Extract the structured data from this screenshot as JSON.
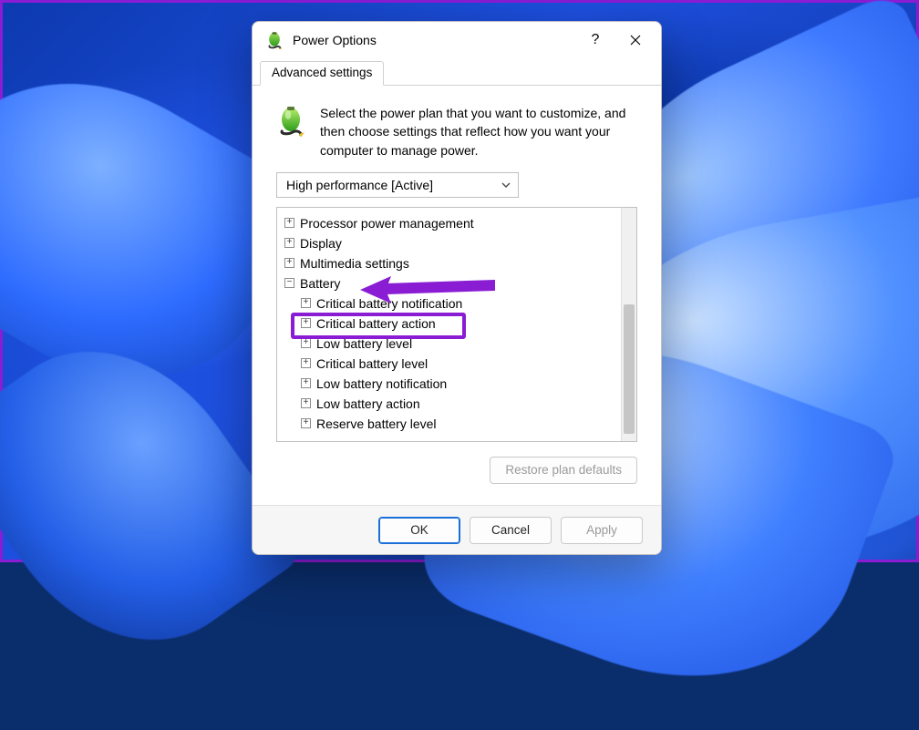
{
  "window": {
    "title": "Power Options",
    "help_glyph": "?",
    "close_label": "Close"
  },
  "tab": {
    "label": "Advanced settings"
  },
  "intro": "Select the power plan that you want to customize, and then choose settings that reflect how you want your computer to manage power.",
  "plan": {
    "selected": "High performance [Active]"
  },
  "tree": {
    "items": [
      {
        "expand": "+",
        "label": "Processor power management",
        "indent": 0
      },
      {
        "expand": "+",
        "label": "Display",
        "indent": 0
      },
      {
        "expand": "+",
        "label": "Multimedia settings",
        "indent": 0
      },
      {
        "expand": "−",
        "label": "Battery",
        "indent": 0
      },
      {
        "expand": "+",
        "label": "Critical battery notification",
        "indent": 1
      },
      {
        "expand": "+",
        "label": "Critical battery action",
        "indent": 1
      },
      {
        "expand": "+",
        "label": "Low battery level",
        "indent": 1
      },
      {
        "expand": "+",
        "label": "Critical battery level",
        "indent": 1
      },
      {
        "expand": "+",
        "label": "Low battery notification",
        "indent": 1
      },
      {
        "expand": "+",
        "label": "Low battery action",
        "indent": 1
      },
      {
        "expand": "+",
        "label": "Reserve battery level",
        "indent": 1
      }
    ]
  },
  "buttons": {
    "restore": "Restore plan defaults",
    "ok": "OK",
    "cancel": "Cancel",
    "apply": "Apply"
  },
  "annotation": {
    "color": "#8a1cd4",
    "arrow_target": "Battery",
    "highlight_target": "Critical battery action"
  }
}
